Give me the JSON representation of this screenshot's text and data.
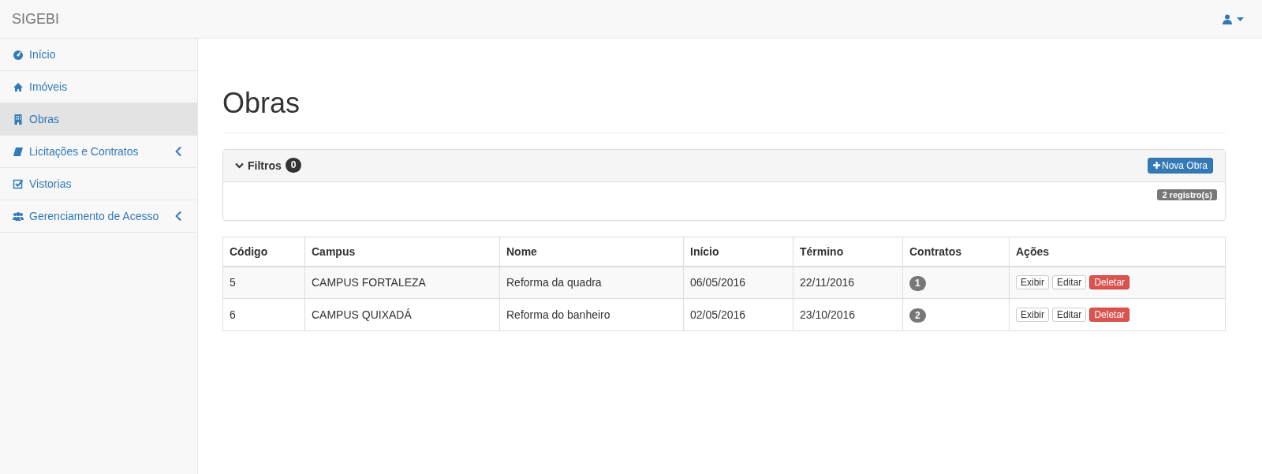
{
  "navbar": {
    "brand": "SIGEBI"
  },
  "sidebar": {
    "items": [
      {
        "label": "Início",
        "kind": "link",
        "selected": false
      },
      {
        "label": "Imóveis",
        "kind": "link",
        "selected": false
      },
      {
        "label": "Obras",
        "kind": "link",
        "selected": true
      },
      {
        "label": "Licitações e Contratos",
        "kind": "submenu",
        "selected": false
      },
      {
        "label": "Vistorias",
        "kind": "link",
        "selected": false
      },
      {
        "label": "Gerenciamento de Acesso",
        "kind": "submenu",
        "selected": false
      }
    ]
  },
  "page": {
    "title": "Obras"
  },
  "filters": {
    "label": "Filtros",
    "count": "0",
    "new_button": "Nova Obra",
    "records": "2 registro(s)"
  },
  "table": {
    "columns": [
      "Código",
      "Campus",
      "Nome",
      "Início",
      "Término",
      "Contratos",
      "Ações"
    ],
    "rows": [
      {
        "codigo": "5",
        "campus": "CAMPUS FORTALEZA",
        "nome": "Reforma da quadra",
        "inicio": "06/05/2016",
        "termino": "22/11/2016",
        "contratos": "1",
        "actions": [
          "Exibir",
          "Editar",
          "Deletar"
        ]
      },
      {
        "codigo": "6",
        "campus": "CAMPUS QUIXADÁ",
        "nome": "Reforma do banheiro",
        "inicio": "02/05/2016",
        "termino": "23/10/2016",
        "contratos": "2",
        "actions": [
          "Exibir",
          "Editar",
          "Deletar"
        ]
      }
    ]
  }
}
